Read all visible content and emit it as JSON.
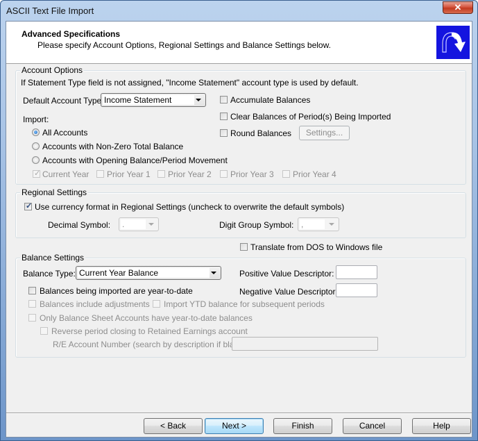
{
  "window": {
    "title": "ASCII Text File Import",
    "close_glyph": "✕"
  },
  "header": {
    "title": "Advanced Specifications",
    "subtitle": "Please specify Account Options, Regional Settings and Balance Settings below.",
    "icon": "redo-arrow-icon"
  },
  "account_options": {
    "legend": "Account Options",
    "note": "If Statement Type field is not assigned, \"Income Statement\" account type is used by default.",
    "default_type_label": "Default Account Type:",
    "default_type_value": "Income Statement",
    "import_label": "Import:",
    "import_options": [
      {
        "label": "All Accounts",
        "selected": true
      },
      {
        "label": "Accounts with Non-Zero Total Balance",
        "selected": false
      },
      {
        "label": "Accounts with Opening Balance/Period Movement",
        "selected": false
      }
    ],
    "years": [
      {
        "label": "Current Year",
        "checked": true,
        "enabled": false
      },
      {
        "label": "Prior Year 1",
        "checked": false,
        "enabled": false
      },
      {
        "label": "Prior Year 2",
        "checked": false,
        "enabled": false
      },
      {
        "label": "Prior Year 3",
        "checked": false,
        "enabled": false
      },
      {
        "label": "Prior Year 4",
        "checked": false,
        "enabled": false
      }
    ],
    "accumulate_balances": {
      "label": "Accumulate Balances",
      "checked": false
    },
    "clear_balances": {
      "label": "Clear Balances of Period(s) Being Imported",
      "checked": false
    },
    "round_balances": {
      "label": "Round Balances",
      "checked": false
    },
    "settings_button": "Settings..."
  },
  "regional": {
    "legend": "Regional Settings",
    "use_currency": {
      "label": "Use currency format in Regional Settings (uncheck to overwrite the default symbols)",
      "checked": true
    },
    "decimal_label": "Decimal Symbol:",
    "decimal_value": ".",
    "digit_group_label": "Digit Group Symbol:",
    "digit_group_value": ","
  },
  "translate": {
    "label": "Translate from DOS to Windows file",
    "checked": false
  },
  "balance": {
    "legend": "Balance Settings",
    "type_label": "Balance Type:",
    "type_value": "Current Year Balance",
    "positive_label": "Positive Value Descriptor:",
    "positive_value": "",
    "negative_label": "Negative Value Descriptor:",
    "negative_value": "",
    "ytd": {
      "label": "Balances being imported are year-to-date",
      "checked": false
    },
    "adjustments": {
      "label": "Balances include adjustments",
      "checked": false
    },
    "import_ytd": {
      "label": "Import YTD balance for subsequent periods",
      "checked": false
    },
    "only_bs": {
      "label": "Only Balance Sheet Accounts have year-to-date balances",
      "checked": false
    },
    "reverse": {
      "label": "Reverse period closing to Retained Earnings account",
      "checked": false
    },
    "re_label": "R/E Account Number (search by description if blank):",
    "re_value": ""
  },
  "footer": {
    "back": "< Back",
    "next": "Next >",
    "finish": "Finish",
    "cancel": "Cancel",
    "help": "Help"
  },
  "check_glyph": "✓"
}
